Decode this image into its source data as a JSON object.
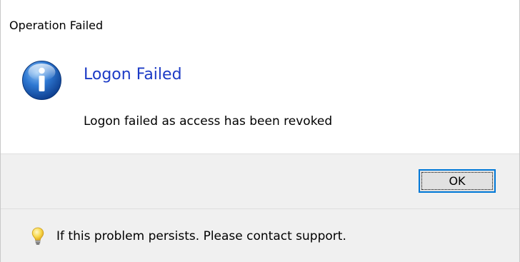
{
  "window": {
    "title": "Operation Failed"
  },
  "content": {
    "icon": "information-icon",
    "main_instruction": "Logon Failed",
    "message": "Logon failed as access has been revoked"
  },
  "buttons": {
    "ok_label": "OK"
  },
  "footer": {
    "icon": "lightbulb-icon",
    "text": "If this problem persists. Please contact support."
  },
  "colors": {
    "main_instruction": "#1c3bc6",
    "button_border_focus": "#0078d7",
    "footer_background": "#f0f0f0"
  }
}
